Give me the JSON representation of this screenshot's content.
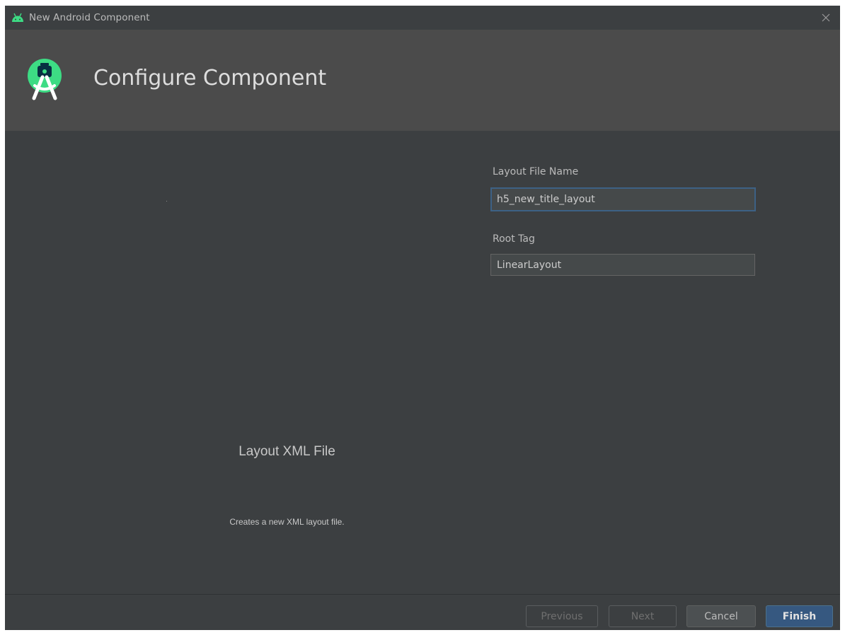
{
  "window": {
    "title": "New Android Component",
    "close_icon": "close-icon"
  },
  "header": {
    "title": "Configure Component",
    "logo_icon": "android-studio-logo-icon"
  },
  "preview": {
    "title": "Layout XML File",
    "description": "Creates a new XML layout file."
  },
  "form": {
    "layout_file_name": {
      "label": "Layout File Name",
      "value": "h5_new_title_layout"
    },
    "root_tag": {
      "label": "Root Tag",
      "value": "LinearLayout"
    }
  },
  "footer": {
    "previous_label": "Previous",
    "next_label": "Next",
    "cancel_label": "Cancel",
    "finish_label": "Finish"
  },
  "colors": {
    "dialog_background": "#3c3f41",
    "header_background": "#4b4b4b",
    "focus_border": "#3d6185",
    "primary_button": "#365880",
    "android_green": "#3ddc84"
  }
}
